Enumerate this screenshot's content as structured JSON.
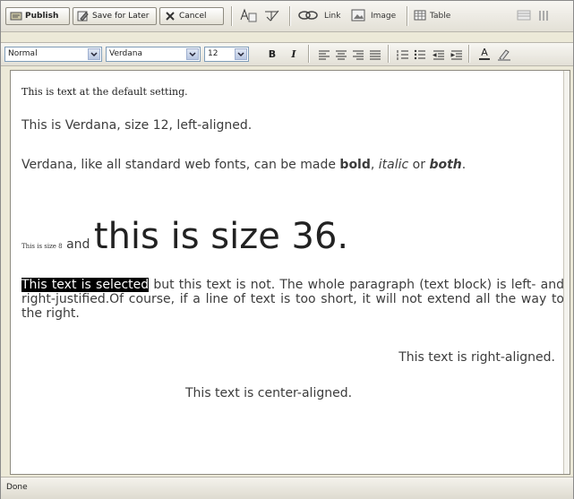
{
  "toolbar": {
    "publish_label": "Publish",
    "save_later_label": "Save for Later",
    "cancel_label": "Cancel",
    "link_label": "Link",
    "image_label": "Image",
    "table_label": "Table"
  },
  "format_bar": {
    "style_value": "Normal",
    "font_value": "Verdana",
    "size_value": "12",
    "bold_label": "B",
    "italic_label": "I",
    "text_color_label": "A"
  },
  "editor": {
    "line1": "This is text at the default setting.",
    "line2": "This is Verdana, size 12, left-aligned.",
    "line3_pre": "Verdana, like all standard web fonts, can be made ",
    "line3_bold": "bold",
    "line3_mid": ", ",
    "line3_italic": "italic",
    "line3_or": " or ",
    "line3_both": "both",
    "line3_end": ".",
    "size8_text": "This is size 8",
    "and_text": " and ",
    "size36_text": "this is size 36.",
    "selected_text": "This text is selected",
    "paragraph_rest": " but this text is not. The whole paragraph (text block) is left- and right-justified.Of course, if a line of text is too short, it will not extend all the way to the right.",
    "right_aligned": "This text is right-aligned.",
    "center_aligned": "This text is center-aligned."
  },
  "status": {
    "text": "Done"
  },
  "colors": {
    "selection_bg": "#000000",
    "editor_bg": "#ffffff",
    "chrome": "#ece9d8"
  }
}
